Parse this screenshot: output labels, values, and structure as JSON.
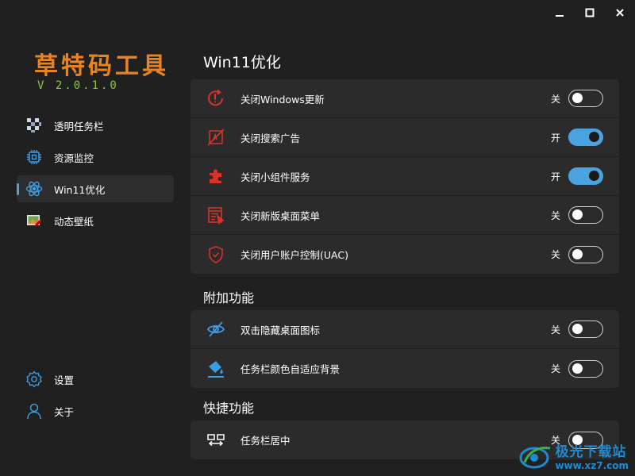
{
  "app": {
    "title": "草特码工具",
    "version": "V 2.0.1.0"
  },
  "window_controls": [
    "minimize-icon",
    "maximize-icon",
    "close-icon"
  ],
  "sidebar": {
    "items": [
      {
        "label": "透明任务栏",
        "icon": "transparent-taskbar-icon",
        "active": false
      },
      {
        "label": "资源监控",
        "icon": "cpu-chip-icon",
        "active": false
      },
      {
        "label": "Win11优化",
        "icon": "atom-icon",
        "active": true
      },
      {
        "label": "动态壁纸",
        "icon": "wallpaper-icon",
        "active": false
      }
    ],
    "bottom_items": [
      {
        "label": "设置",
        "icon": "gear-icon"
      },
      {
        "label": "关于",
        "icon": "user-icon"
      }
    ]
  },
  "sections": [
    {
      "title": "Win11优化",
      "rows": [
        {
          "label": "关闭Windows更新",
          "state": "关",
          "on": false,
          "icon": "update-icon"
        },
        {
          "label": "关闭搜索广告",
          "state": "开",
          "on": true,
          "icon": "no-ads-icon"
        },
        {
          "label": "关闭小组件服务",
          "state": "开",
          "on": true,
          "icon": "puzzle-icon"
        },
        {
          "label": "关闭新版桌面菜单",
          "state": "关",
          "on": false,
          "icon": "context-menu-icon"
        },
        {
          "label": "关闭用户账户控制(UAC)",
          "state": "关",
          "on": false,
          "icon": "shield-icon"
        }
      ]
    },
    {
      "title": "附加功能",
      "rows": [
        {
          "label": "双击隐藏桌面图标",
          "state": "关",
          "on": false,
          "icon": "eye-off-icon"
        },
        {
          "label": "任务栏颜色自适应背景",
          "state": "关",
          "on": false,
          "icon": "paint-icon"
        }
      ]
    },
    {
      "title": "快捷功能",
      "rows": [
        {
          "label": "任务栏居中",
          "state": "关",
          "on": false,
          "icon": "taskbar-center-icon"
        }
      ]
    }
  ],
  "watermark": {
    "cn": "极光下载站",
    "url": "www.xz7.com"
  },
  "colors": {
    "accent": "#4aa3df",
    "title_orange": "#e9831f",
    "version_green": "#8ec63f",
    "icon_red": "#d9322a",
    "background": "#202020",
    "card": "#2b2b2b"
  }
}
